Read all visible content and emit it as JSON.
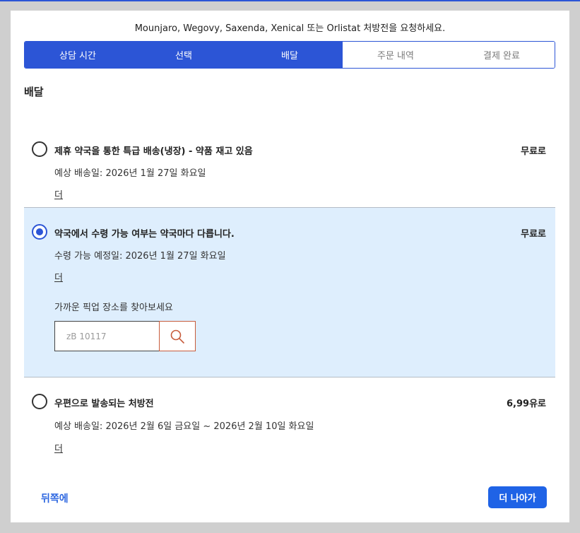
{
  "headline": "Mounjaro, Wegovy, Saxenda, Xenical 또는 Orlistat 처방전을 요청하세요.",
  "steps": [
    {
      "label": "상담 시간",
      "state": "done"
    },
    {
      "label": "선택",
      "state": "done"
    },
    {
      "label": "배달",
      "state": "done"
    },
    {
      "label": "주문 내역",
      "state": "todo"
    },
    {
      "label": "결제 완료",
      "state": "todo"
    }
  ],
  "section_title": "배달",
  "options": [
    {
      "title": "제휴 약국을 통한 특급 배송(냉장) - 약품 재고 있음",
      "price": "무료로",
      "subtitle": "예상 배송일: 2026년 1월 27일 화요일",
      "more": "더",
      "selected": false
    },
    {
      "title": "약국에서 수령 가능 여부는 약국마다 다릅니다.",
      "price": "무료로",
      "subtitle": "수령 가능 예정일: 2026년 1월 27일 화요일",
      "more": "더",
      "selected": true,
      "pickup_label": "가까운 픽업 장소를 찾아보세요",
      "zip_placeholder": "zB 10117"
    },
    {
      "title": "우편으로 발송되는 처방전",
      "price": "6,99유로",
      "subtitle": "예상 배송일: 2026년 2월 6일 금요일 ~ 2026년 2월 10일 화요일",
      "more": "더",
      "selected": false
    }
  ],
  "footer": {
    "back_label": "뒤쪽에",
    "next_label": "더 나아가"
  },
  "colors": {
    "accent": "#2c55d6",
    "selected_bg": "#deeefd",
    "search_border": "#c75b3b",
    "next_button": "#1f63e6"
  }
}
